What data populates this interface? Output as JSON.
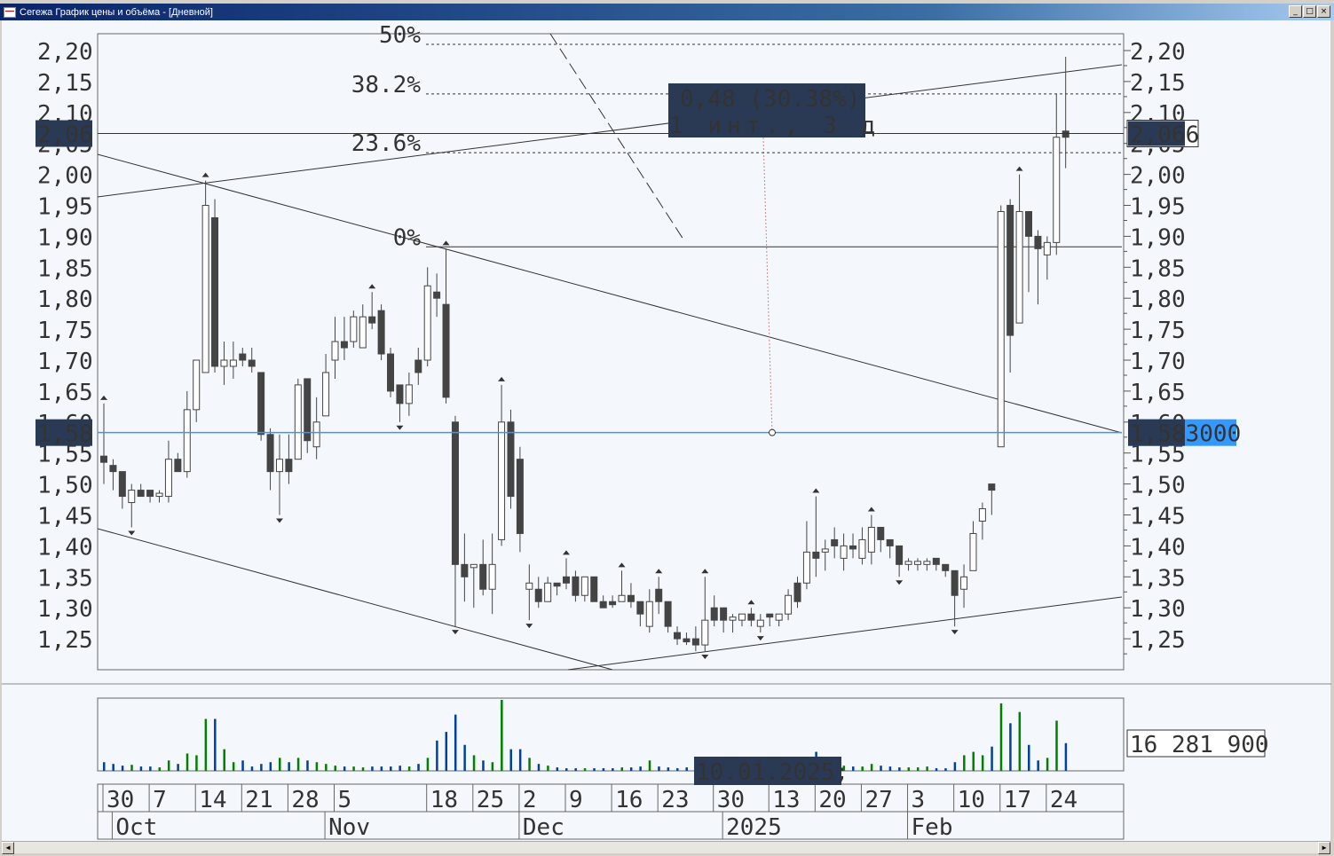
{
  "window": {
    "title": "Сегежа График цены и объёма - [Дневной]",
    "buttons": [
      "_",
      "□",
      "×"
    ]
  },
  "price_axis": {
    "ticks": [
      "2,20",
      "2,15",
      "2,10",
      "2,05",
      "2,00",
      "1,95",
      "1,90",
      "1,85",
      "1,80",
      "1,75",
      "1,70",
      "1,65",
      "1,60",
      "1,55",
      "1,50",
      "1,45",
      "1,40",
      "1,35",
      "1,30",
      "1,25"
    ],
    "tick_values": [
      2.2,
      2.15,
      2.1,
      2.05,
      2.0,
      1.95,
      1.9,
      1.85,
      1.8,
      1.75,
      1.7,
      1.65,
      1.6,
      1.55,
      1.5,
      1.45,
      1.4,
      1.35,
      1.3,
      1.25
    ],
    "range": [
      1.21,
      2.225
    ]
  },
  "markers": {
    "last_left": "2,06",
    "last_right": "2,066",
    "last_value": 2.066,
    "cursor_left": "1,58",
    "cursor_right": "1,583000",
    "cursor_value": 1.583
  },
  "fib": {
    "levels": [
      {
        "label": "50%",
        "value": 2.21
      },
      {
        "label": "38.2%",
        "value": 2.13
      },
      {
        "label": "23.6%",
        "value": 2.035
      },
      {
        "label": "0%",
        "value": 1.883
      }
    ]
  },
  "tooltip": {
    "line1": "0,48 (30.38%)",
    "line2": "1 инт., 3 д"
  },
  "volume": {
    "max_label": "16 281 900",
    "cursor_date": "10.01.2025;",
    "colors": {
      "up": "#008000",
      "down": "#0040a0"
    }
  },
  "colors": {
    "bg": "#f4f8fc",
    "candle": "#444444",
    "cursor": "#3399ff",
    "label_bg": "#2a3a55"
  },
  "candles": [
    [
      1.545,
      1.63,
      1.5,
      1.535
    ],
    [
      1.53,
      1.54,
      1.49,
      1.52
    ],
    [
      1.52,
      1.52,
      1.46,
      1.48
    ],
    [
      1.47,
      1.5,
      1.43,
      1.49
    ],
    [
      1.49,
      1.5,
      1.48,
      1.48
    ],
    [
      1.49,
      1.49,
      1.47,
      1.48
    ],
    [
      1.48,
      1.49,
      1.47,
      1.485
    ],
    [
      1.48,
      1.57,
      1.47,
      1.54
    ],
    [
      1.54,
      1.55,
      1.52,
      1.52
    ],
    [
      1.52,
      1.65,
      1.51,
      1.62
    ],
    [
      1.62,
      1.7,
      1.6,
      1.7
    ],
    [
      1.68,
      1.99,
      1.68,
      1.95
    ],
    [
      1.93,
      1.96,
      1.68,
      1.69
    ],
    [
      1.69,
      1.73,
      1.66,
      1.7
    ],
    [
      1.69,
      1.73,
      1.67,
      1.7
    ],
    [
      1.71,
      1.72,
      1.69,
      1.7
    ],
    [
      1.7,
      1.72,
      1.68,
      1.69
    ],
    [
      1.68,
      1.68,
      1.57,
      1.58
    ],
    [
      1.58,
      1.59,
      1.49,
      1.52
    ],
    [
      1.52,
      1.58,
      1.45,
      1.54
    ],
    [
      1.54,
      1.58,
      1.5,
      1.52
    ],
    [
      1.54,
      1.67,
      1.54,
      1.66
    ],
    [
      1.67,
      1.67,
      1.55,
      1.57
    ],
    [
      1.56,
      1.64,
      1.54,
      1.6
    ],
    [
      1.61,
      1.71,
      1.61,
      1.68
    ],
    [
      1.7,
      1.77,
      1.67,
      1.73
    ],
    [
      1.73,
      1.77,
      1.7,
      1.72
    ],
    [
      1.73,
      1.78,
      1.72,
      1.77
    ],
    [
      1.72,
      1.79,
      1.72,
      1.77
    ],
    [
      1.77,
      1.81,
      1.75,
      1.76
    ],
    [
      1.78,
      1.79,
      1.7,
      1.71
    ],
    [
      1.71,
      1.72,
      1.64,
      1.65
    ],
    [
      1.66,
      1.66,
      1.6,
      1.63
    ],
    [
      1.63,
      1.68,
      1.61,
      1.66
    ],
    [
      1.7,
      1.72,
      1.66,
      1.68
    ],
    [
      1.7,
      1.85,
      1.69,
      1.82
    ],
    [
      1.81,
      1.84,
      1.77,
      1.8
    ],
    [
      1.79,
      1.88,
      1.63,
      1.64
    ],
    [
      1.6,
      1.61,
      1.27,
      1.37
    ],
    [
      1.37,
      1.42,
      1.31,
      1.35
    ],
    [
      1.365,
      1.37,
      1.3,
      1.37
    ],
    [
      1.37,
      1.41,
      1.32,
      1.33
    ],
    [
      1.33,
      1.42,
      1.29,
      1.37
    ],
    [
      1.41,
      1.66,
      1.4,
      1.6
    ],
    [
      1.6,
      1.62,
      1.46,
      1.48
    ],
    [
      1.54,
      1.56,
      1.39,
      1.42
    ],
    [
      1.33,
      1.37,
      1.28,
      1.34
    ],
    [
      1.33,
      1.35,
      1.3,
      1.31
    ],
    [
      1.31,
      1.35,
      1.31,
      1.34
    ],
    [
      1.34,
      1.34,
      1.32,
      1.335
    ],
    [
      1.35,
      1.38,
      1.33,
      1.34
    ],
    [
      1.35,
      1.36,
      1.31,
      1.32
    ],
    [
      1.32,
      1.35,
      1.31,
      1.35
    ],
    [
      1.35,
      1.35,
      1.31,
      1.31
    ],
    [
      1.31,
      1.32,
      1.3,
      1.3
    ],
    [
      1.31,
      1.32,
      1.3,
      1.305
    ],
    [
      1.31,
      1.36,
      1.31,
      1.32
    ],
    [
      1.32,
      1.34,
      1.3,
      1.31
    ],
    [
      1.31,
      1.31,
      1.27,
      1.29
    ],
    [
      1.27,
      1.33,
      1.26,
      1.31
    ],
    [
      1.33,
      1.35,
      1.29,
      1.31
    ],
    [
      1.31,
      1.31,
      1.26,
      1.27
    ],
    [
      1.26,
      1.27,
      1.24,
      1.25
    ],
    [
      1.25,
      1.26,
      1.24,
      1.245
    ],
    [
      1.25,
      1.27,
      1.23,
      1.24
    ],
    [
      1.24,
      1.35,
      1.23,
      1.28
    ],
    [
      1.3,
      1.32,
      1.27,
      1.28
    ],
    [
      1.3,
      1.3,
      1.26,
      1.28
    ],
    [
      1.28,
      1.29,
      1.26,
      1.285
    ],
    [
      1.28,
      1.29,
      1.27,
      1.29
    ],
    [
      1.29,
      1.3,
      1.27,
      1.28
    ],
    [
      1.27,
      1.29,
      1.26,
      1.28
    ],
    [
      1.29,
      1.29,
      1.27,
      1.285
    ],
    [
      1.28,
      1.29,
      1.27,
      1.29
    ],
    [
      1.29,
      1.33,
      1.28,
      1.32
    ],
    [
      1.34,
      1.35,
      1.3,
      1.31
    ],
    [
      1.34,
      1.44,
      1.33,
      1.39
    ],
    [
      1.39,
      1.48,
      1.35,
      1.38
    ],
    [
      1.39,
      1.41,
      1.36,
      1.395
    ],
    [
      1.41,
      1.43,
      1.38,
      1.4
    ],
    [
      1.38,
      1.42,
      1.36,
      1.4
    ],
    [
      1.4,
      1.42,
      1.38,
      1.395
    ],
    [
      1.38,
      1.43,
      1.37,
      1.41
    ],
    [
      1.39,
      1.45,
      1.37,
      1.43
    ],
    [
      1.43,
      1.43,
      1.39,
      1.41
    ],
    [
      1.41,
      1.41,
      1.38,
      1.4
    ],
    [
      1.4,
      1.4,
      1.35,
      1.37
    ],
    [
      1.37,
      1.38,
      1.36,
      1.375
    ],
    [
      1.37,
      1.38,
      1.36,
      1.375
    ],
    [
      1.37,
      1.38,
      1.36,
      1.375
    ],
    [
      1.38,
      1.38,
      1.36,
      1.37
    ],
    [
      1.37,
      1.37,
      1.35,
      1.36
    ],
    [
      1.36,
      1.36,
      1.27,
      1.32
    ],
    [
      1.33,
      1.37,
      1.3,
      1.35
    ],
    [
      1.36,
      1.44,
      1.36,
      1.42
    ],
    [
      1.44,
      1.47,
      1.41,
      1.46
    ],
    [
      1.5,
      1.5,
      1.45,
      1.49
    ],
    [
      1.56,
      1.95,
      1.56,
      1.94
    ],
    [
      1.95,
      1.96,
      1.68,
      1.74
    ],
    [
      1.76,
      2.0,
      1.76,
      1.94
    ],
    [
      1.94,
      1.94,
      1.81,
      1.9
    ],
    [
      1.9,
      1.91,
      1.79,
      1.88
    ],
    [
      1.87,
      1.9,
      1.83,
      1.89
    ],
    [
      1.89,
      2.13,
      1.87,
      2.06
    ],
    [
      2.07,
      2.19,
      2.01,
      2.06
    ]
  ],
  "up_arrows": [
    0,
    11,
    29,
    37,
    43,
    50,
    56,
    60,
    65,
    70,
    77,
    83,
    99
  ],
  "down_arrows": [
    3,
    19,
    32,
    38,
    46,
    65,
    71,
    86,
    92
  ],
  "volumes": [
    10,
    8,
    6,
    7,
    5,
    5,
    4,
    12,
    8,
    20,
    18,
    60,
    60,
    25,
    10,
    12,
    5,
    8,
    10,
    15,
    10,
    15,
    12,
    10,
    8,
    6,
    5,
    5,
    4,
    5,
    5,
    5,
    6,
    5,
    8,
    15,
    35,
    45,
    65,
    30,
    18,
    12,
    10,
    82,
    25,
    25,
    15,
    8,
    6,
    4,
    3,
    3,
    3,
    3,
    3,
    3,
    4,
    4,
    5,
    12,
    5,
    4,
    3,
    4,
    6,
    8,
    5,
    4,
    4,
    3,
    5,
    4,
    5,
    6,
    5,
    6,
    10,
    22,
    12,
    5,
    6,
    5,
    5,
    8,
    6,
    5,
    4,
    4,
    4,
    5,
    3,
    3,
    10,
    18,
    22,
    18,
    28,
    78,
    55,
    68,
    30,
    12,
    15,
    58,
    32
  ],
  "x_axis": {
    "days": [
      {
        "label": "30",
        "i": 0
      },
      {
        "label": "7",
        "i": 5
      },
      {
        "label": "14",
        "i": 10
      },
      {
        "label": "21",
        "i": 15
      },
      {
        "label": "28",
        "i": 20
      },
      {
        "label": "5",
        "i": 25
      },
      {
        "label": "18",
        "i": 35
      },
      {
        "label": "25",
        "i": 40
      },
      {
        "label": "2",
        "i": 45
      },
      {
        "label": "9",
        "i": 50
      },
      {
        "label": "16",
        "i": 55
      },
      {
        "label": "23",
        "i": 60
      },
      {
        "label": "30",
        "i": 66
      },
      {
        "label": "13",
        "i": 72
      },
      {
        "label": "20",
        "i": 77
      },
      {
        "label": "27",
        "i": 82
      },
      {
        "label": "3",
        "i": 87
      },
      {
        "label": "10",
        "i": 92
      },
      {
        "label": "17",
        "i": 97
      },
      {
        "label": "24",
        "i": 102
      }
    ],
    "months": [
      {
        "label": "Oct",
        "i": 1
      },
      {
        "label": "Nov",
        "i": 24
      },
      {
        "label": "Dec",
        "i": 45
      },
      {
        "label": "2025",
        "i": 67
      },
      {
        "label": "Feb",
        "i": 87
      }
    ]
  }
}
